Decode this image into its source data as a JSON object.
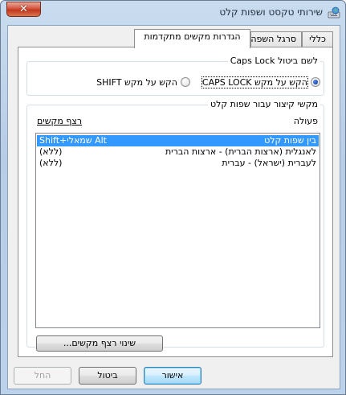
{
  "window": {
    "title": "שירותי טקסט ושפות קלט",
    "close_glyph": "✕",
    "app_icon": "keyboard-globe-icon"
  },
  "tabs": [
    {
      "label": "כללי",
      "active": false
    },
    {
      "label": "סרגל השפה",
      "active": false
    },
    {
      "label": "הגדרות מקשים מתקדמות",
      "active": true
    }
  ],
  "caps_lock_group": {
    "title": "לשם ביטול Caps Lock",
    "option_caps": "הקש על מקש CAPS LOCK",
    "option_shift": "הקש על מקש SHIFT",
    "selected": "caps"
  },
  "hotkeys_group": {
    "title": "מקשי קיצור עבור שפות קלט",
    "col_action": "פעולה",
    "col_keys": "רצף מקשים",
    "rows": [
      {
        "action": "בין שפות קלט",
        "keys": "Alt שמאלי+Shift",
        "selected": true
      },
      {
        "action": "לאנגלית (ארצות הברית) - ארצות הברית",
        "keys": "(ללא)",
        "selected": false
      },
      {
        "action": "לעברית (ישראל) - עברית",
        "keys": "(ללא)",
        "selected": false
      }
    ],
    "change_button": "שינוי רצף מקשים..."
  },
  "footer": {
    "ok": "אישור",
    "cancel": "ביטול",
    "apply": "החל"
  },
  "colors": {
    "selection": "#3399ff",
    "panel": "#f0f0f0"
  }
}
